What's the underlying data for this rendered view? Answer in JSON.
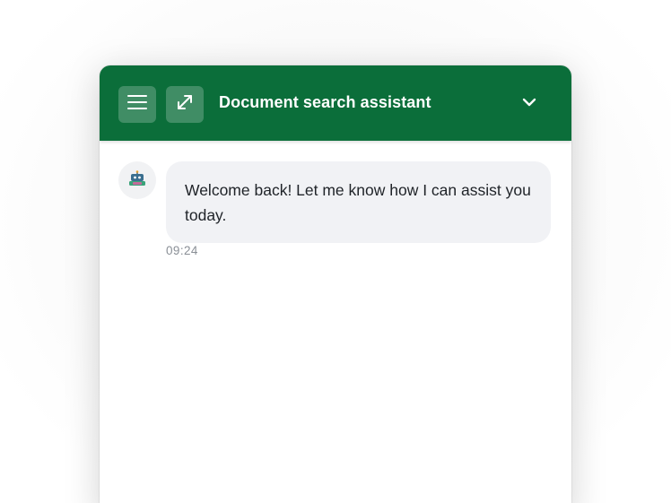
{
  "header": {
    "title": "Document search assistant",
    "menu_icon": "hamburger-menu-icon",
    "expand_icon": "expand-arrows-icon",
    "collapse_icon": "chevron-down-icon",
    "background_color": "#0b6e3a"
  },
  "messages": [
    {
      "sender": "bot",
      "avatar_icon": "robot-icon",
      "text": "Welcome back! Let me know how I can assist you today.",
      "time": "09:24"
    }
  ],
  "colors": {
    "accent": "#0b6e3a",
    "bubble_bg": "#f1f2f5",
    "timestamp": "#8a8f96"
  }
}
